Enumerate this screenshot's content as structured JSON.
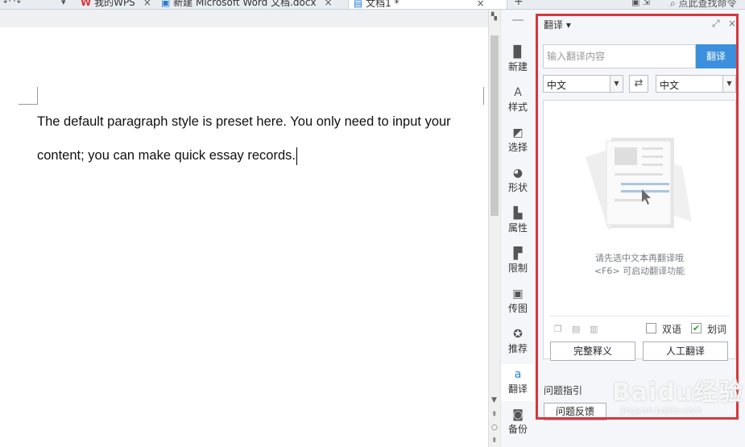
{
  "tabs": [
    {
      "label": "我的WPS",
      "close": "×"
    },
    {
      "label": "新建 Microsoft Word 文档.docx",
      "close": "×"
    },
    {
      "label": "文档1 *",
      "close": "×"
    }
  ],
  "tabbar_search": "点此查找命令",
  "document": {
    "line1": "The default paragraph style is preset here. You only need to input your",
    "line2": "content; you can make quick essay records."
  },
  "rail": [
    {
      "label": "新建",
      "icon": "file-icon"
    },
    {
      "label": "样式",
      "icon": "style-icon"
    },
    {
      "label": "选择",
      "icon": "select-icon"
    },
    {
      "label": "形状",
      "icon": "shape-icon"
    },
    {
      "label": "属性",
      "icon": "properties-icon"
    },
    {
      "label": "限制",
      "icon": "restrict-icon"
    },
    {
      "label": "传图",
      "icon": "image-upload-icon"
    },
    {
      "label": "推荐",
      "icon": "recommend-icon"
    },
    {
      "label": "翻译",
      "icon": "translate-icon"
    },
    {
      "label": "备份",
      "icon": "backup-icon"
    }
  ],
  "panel": {
    "title": "翻译 ▾",
    "input_placeholder": "输入翻译内容",
    "translate_button": "翻译",
    "source_lang": "中文",
    "target_lang": "中文",
    "hint_line1": "请先选中文本再翻译哦",
    "hint_line2": "<F6> 可启动翻译功能",
    "bilingual_label": "双语",
    "word_pick_label": "划词",
    "word_pick_checked": true,
    "full_definition_button": "完整释义",
    "human_translation_button": "人工翻译",
    "faq_title": "问题指引",
    "feedback_button": "问题反馈"
  },
  "watermark": {
    "text": "Baidu经验",
    "sub": "jingyan.baidu.com"
  },
  "colors": {
    "accent": "#3b8fdd",
    "highlight_frame": "#d9363b"
  }
}
